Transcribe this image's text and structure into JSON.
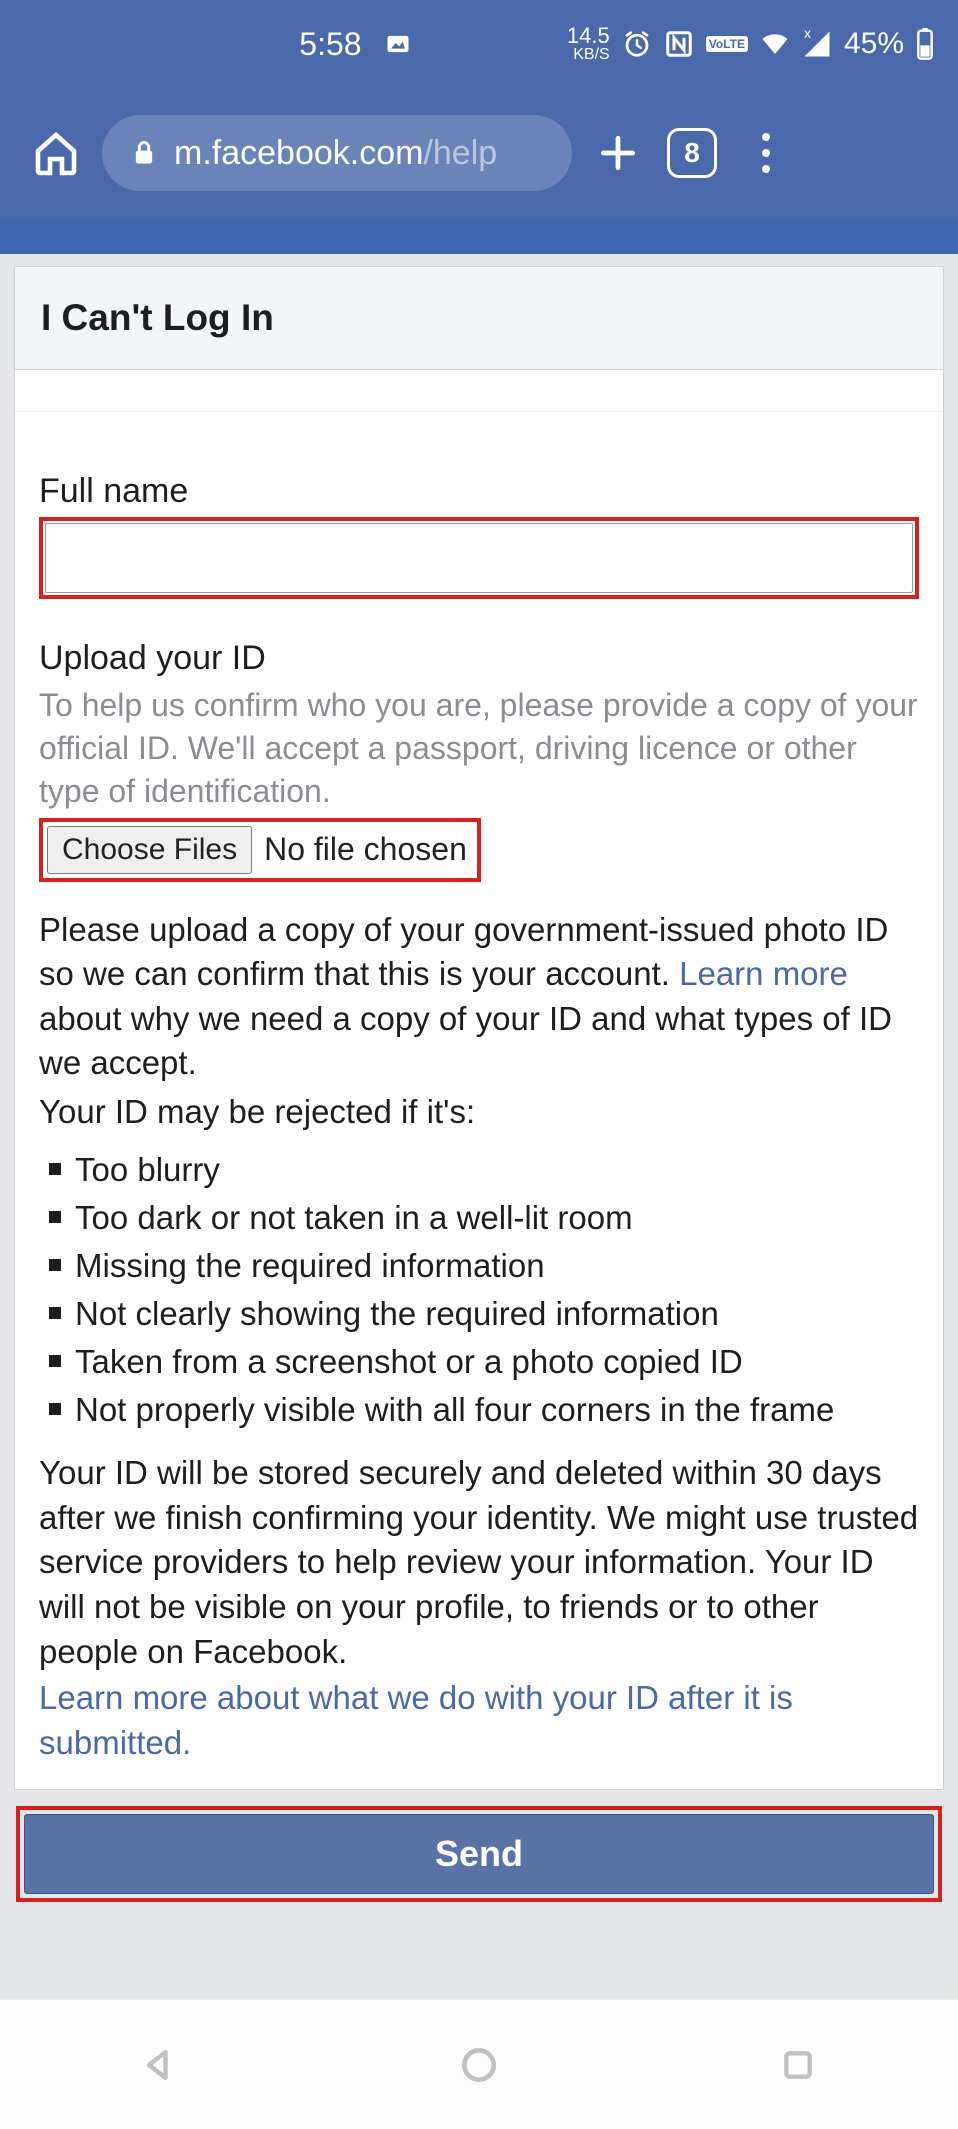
{
  "status": {
    "time": "5:58",
    "data_rate_number": "14.5",
    "data_rate_unit": "KB/S",
    "volte": "Vo LTE",
    "battery_percent": "45%"
  },
  "browser": {
    "url_host": "m.facebook.com",
    "url_path": "/help",
    "tab_count": "8"
  },
  "page": {
    "title": "I Can't Log In",
    "full_name_label": "Full name",
    "full_name_value": "",
    "upload_label": "Upload your ID",
    "upload_help": "To help us confirm who you are, please provide a copy of your official ID. We'll accept a passport, driving licence or other type of identification.",
    "choose_files_label": "Choose Files",
    "no_file_chosen": "No file chosen",
    "para1_a": "Please upload a copy of your government-issued photo ID so we can confirm that this is your account. ",
    "para1_link": "Learn more",
    "para1_b": " about why we need a copy of your ID and what types of ID we accept.",
    "reject_intro": "Your ID may be rejected if it's:",
    "reject_reasons": [
      "Too blurry",
      "Too dark or not taken in a well-lit room",
      "Missing the required information",
      "Not clearly showing the required information",
      "Taken from a screenshot or a photo copied ID",
      "Not properly visible with all four corners in the frame"
    ],
    "storage_text": "Your ID will be stored securely and deleted within 30 days after we finish confirming your identity. We might use trusted service providers to help review your information. Your ID will not be visible on your profile, to friends or to other people on Facebook.",
    "learn_more_2": "Learn more about what we do with your ID after it is submitted.",
    "send_label": "Send"
  }
}
